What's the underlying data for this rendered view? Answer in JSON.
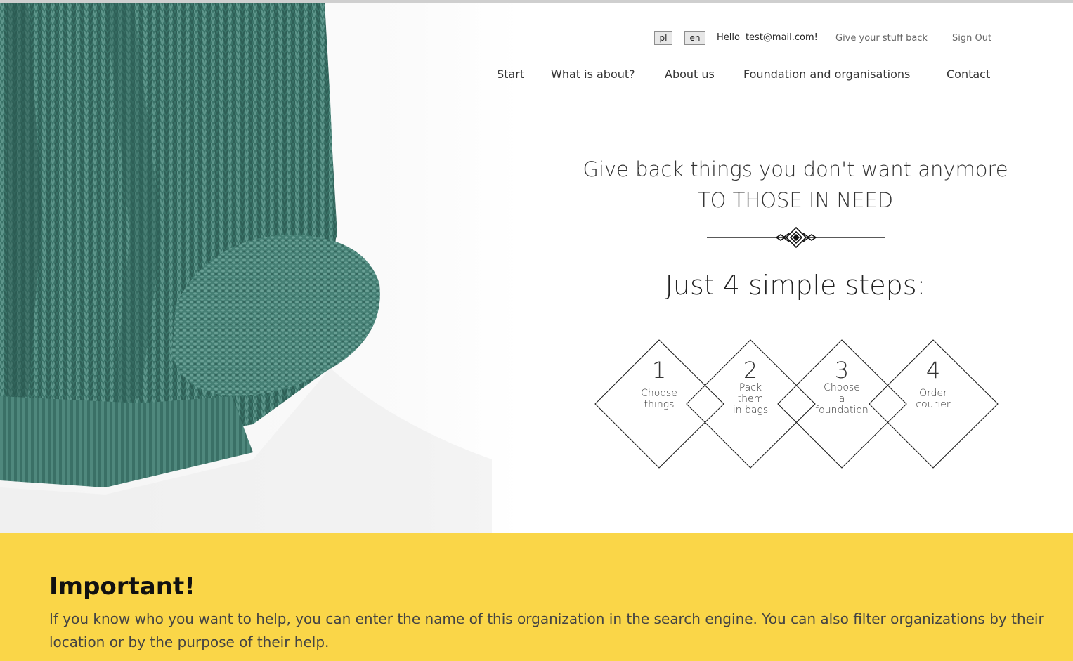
{
  "topbar": {
    "lang_pl": "pl",
    "lang_en": "en",
    "hello_label": "Hello",
    "user_email": "test@mail.com!",
    "give_link": "Give your stuff back",
    "signout_link": "Sign Out"
  },
  "nav": {
    "start": "Start",
    "what": "What is about?",
    "about": "About us",
    "foundations": "Foundation and organisations",
    "contact": "Contact"
  },
  "hero": {
    "headline_line1": "Give back things you don't want anymore",
    "headline_line2": "TO THOSE IN NEED",
    "steps_title": "Just 4 simple steps:",
    "steps": [
      {
        "number": "1",
        "label_lines": [
          "Choose",
          "things"
        ]
      },
      {
        "number": "2",
        "label_lines": [
          "Pack",
          "them",
          "in bags"
        ]
      },
      {
        "number": "3",
        "label_lines": [
          "Choose",
          "a",
          "foundation"
        ]
      },
      {
        "number": "4",
        "label_lines": [
          "Order",
          "courier"
        ]
      }
    ]
  },
  "important": {
    "title": "Important!",
    "text": "If you know who you want to help, you can enter the name of this organization in the search engine. You can also filter organizations by their location or by the purpose of their help."
  },
  "colors": {
    "band": "#fad648",
    "sweater": "#3f7a70",
    "text": "#333333"
  },
  "icons": {
    "ornament": "divider-ornament-icon",
    "hero_photo": "knitted-sweater-photo"
  }
}
